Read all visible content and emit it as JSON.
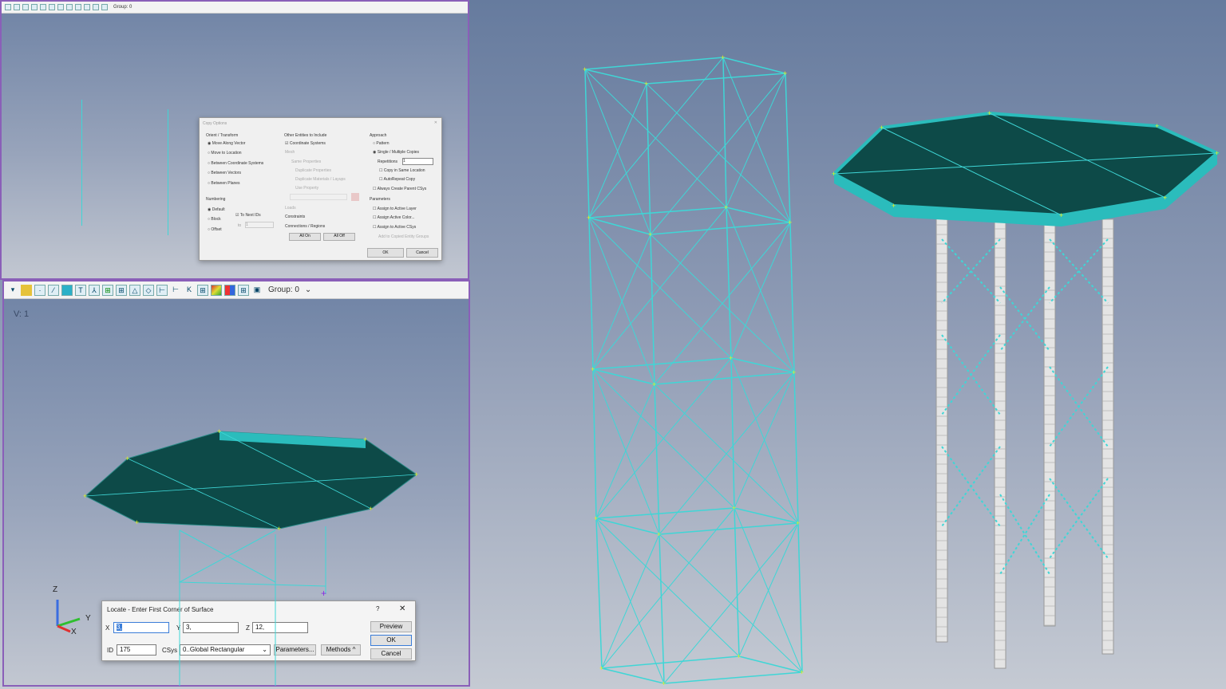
{
  "top_toolbar": {
    "group_label": "Group: 0"
  },
  "copy_dialog": {
    "title": "Copy Options",
    "orient_title": "Orient / Transform",
    "orient_options": [
      "Move Along Vector",
      "Move to Location",
      "Between Coordinate Systems",
      "Between Vectors",
      "Between Planes"
    ],
    "numbering_title": "Numbering",
    "numbering_options": [
      "Default",
      "Block",
      "Offset"
    ],
    "to_next_ids": "To Next IDs",
    "to_label": "to",
    "to_value": "1",
    "other_title": "Other Entities to Include",
    "other_items": [
      "Coordinate Systems",
      "Mesh",
      "Same Properties",
      "Duplicate Properties",
      "Duplicate Materials / Layups",
      "Use Property",
      "Loads",
      "Constraints",
      "Connections / Regions"
    ],
    "all_on": "All On",
    "all_off": "All Off",
    "approach_title": "Approach",
    "approach_options": [
      "Pattern",
      "Single / Multiple Copies"
    ],
    "repetitions_label": "Repetitions",
    "repetitions_value": "1",
    "approach_checks": [
      "Copy in Same Location",
      "AutoRepeat Copy",
      "Always Create Parent CSys"
    ],
    "parameters_title": "Parameters",
    "parameter_checks": [
      "Assign to Active Layer",
      "Assign Active Color...",
      "Assign to Active CSys",
      "Add to Copied Entity Groups"
    ],
    "ok": "OK",
    "cancel": "Cancel"
  },
  "bottom_toolbar": {
    "group_label": "Group: 0"
  },
  "viewport": {
    "view_label": "V: 1",
    "axes": {
      "z": "Z",
      "y": "Y",
      "x": "X"
    }
  },
  "locate_dialog": {
    "title": "Locate - Enter First Corner of Surface",
    "help": "?",
    "close": "✕",
    "x_label": "X",
    "x_value": "3,",
    "y_label": "Y",
    "y_value": "3,",
    "z_label": "Z",
    "z_value": "12,",
    "id_label": "ID",
    "id_value": "175",
    "csys_label": "CSys",
    "csys_value": "0..Global Rectangular",
    "parameters": "Parameters...",
    "methods": "Methods ^",
    "preview": "Preview",
    "ok": "OK",
    "cancel": "Cancel"
  },
  "colors": {
    "beam": "#3fd6d6",
    "node": "#e8f020",
    "plate": "#0d4a48",
    "plate_edge": "#2bbcbc",
    "frame": "#8a5fb8"
  }
}
